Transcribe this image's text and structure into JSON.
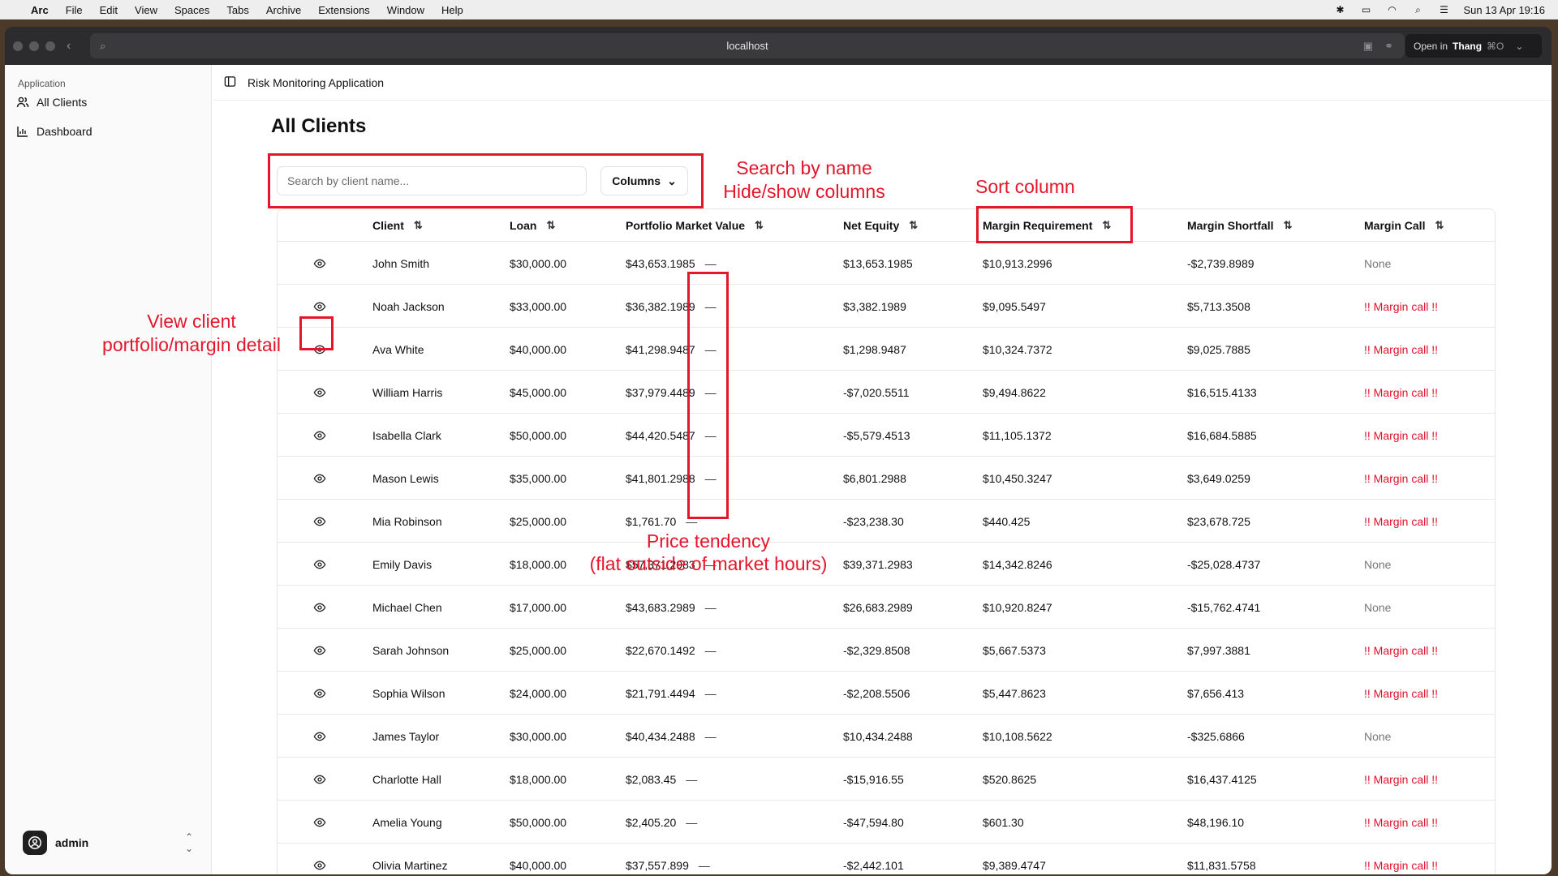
{
  "menubar": {
    "app": "Arc",
    "items": [
      "File",
      "Edit",
      "View",
      "Spaces",
      "Tabs",
      "Archive",
      "Extensions",
      "Window",
      "Help"
    ],
    "datetime": "Sun 13 Apr  19:16"
  },
  "browser": {
    "url": "localhost",
    "open_in_label": "Open in",
    "open_in_target": "Thang",
    "open_in_shortcut": "⌘O"
  },
  "sidebar": {
    "group_label": "Application",
    "items": [
      {
        "label": "All Clients",
        "icon": "users-icon"
      },
      {
        "label": "Dashboard",
        "icon": "chart-icon"
      }
    ],
    "user": "admin"
  },
  "header": {
    "breadcrumb": "Risk Monitoring Application"
  },
  "page": {
    "title": "All Clients",
    "search_placeholder": "Search by client name...",
    "columns_label": "Columns"
  },
  "table": {
    "headers": [
      "Client",
      "Loan",
      "Portfolio Market Value",
      "Net Equity",
      "Margin Requirement",
      "Margin Shortfall",
      "Margin Call"
    ],
    "trend_symbol": "—",
    "rows": [
      {
        "client": "John Smith",
        "loan": "$30,000.00",
        "pmv": "$43,653.1985",
        "equity": "$13,653.1985",
        "req": "$10,913.2996",
        "shortfall": "-$2,739.8989",
        "call": "None"
      },
      {
        "client": "Noah Jackson",
        "loan": "$33,000.00",
        "pmv": "$36,382.1989",
        "equity": "$3,382.1989",
        "req": "$9,095.5497",
        "shortfall": "$5,713.3508",
        "call": "!! Margin call !!"
      },
      {
        "client": "Ava White",
        "loan": "$40,000.00",
        "pmv": "$41,298.9487",
        "equity": "$1,298.9487",
        "req": "$10,324.7372",
        "shortfall": "$9,025.7885",
        "call": "!! Margin call !!"
      },
      {
        "client": "William Harris",
        "loan": "$45,000.00",
        "pmv": "$37,979.4489",
        "equity": "-$7,020.5511",
        "req": "$9,494.8622",
        "shortfall": "$16,515.4133",
        "call": "!! Margin call !!"
      },
      {
        "client": "Isabella Clark",
        "loan": "$50,000.00",
        "pmv": "$44,420.5487",
        "equity": "-$5,579.4513",
        "req": "$11,105.1372",
        "shortfall": "$16,684.5885",
        "call": "!! Margin call !!"
      },
      {
        "client": "Mason Lewis",
        "loan": "$35,000.00",
        "pmv": "$41,801.2988",
        "equity": "$6,801.2988",
        "req": "$10,450.3247",
        "shortfall": "$3,649.0259",
        "call": "!! Margin call !!"
      },
      {
        "client": "Mia Robinson",
        "loan": "$25,000.00",
        "pmv": "$1,761.70",
        "equity": "-$23,238.30",
        "req": "$440.425",
        "shortfall": "$23,678.725",
        "call": "!! Margin call !!"
      },
      {
        "client": "Emily Davis",
        "loan": "$18,000.00",
        "pmv": "$57,371.2983",
        "equity": "$39,371.2983",
        "req": "$14,342.8246",
        "shortfall": "-$25,028.4737",
        "call": "None"
      },
      {
        "client": "Michael Chen",
        "loan": "$17,000.00",
        "pmv": "$43,683.2989",
        "equity": "$26,683.2989",
        "req": "$10,920.8247",
        "shortfall": "-$15,762.4741",
        "call": "None"
      },
      {
        "client": "Sarah Johnson",
        "loan": "$25,000.00",
        "pmv": "$22,670.1492",
        "equity": "-$2,329.8508",
        "req": "$5,667.5373",
        "shortfall": "$7,997.3881",
        "call": "!! Margin call !!"
      },
      {
        "client": "Sophia Wilson",
        "loan": "$24,000.00",
        "pmv": "$21,791.4494",
        "equity": "-$2,208.5506",
        "req": "$5,447.8623",
        "shortfall": "$7,656.413",
        "call": "!! Margin call !!"
      },
      {
        "client": "James Taylor",
        "loan": "$30,000.00",
        "pmv": "$40,434.2488",
        "equity": "$10,434.2488",
        "req": "$10,108.5622",
        "shortfall": "-$325.6866",
        "call": "None"
      },
      {
        "client": "Charlotte Hall",
        "loan": "$18,000.00",
        "pmv": "$2,083.45",
        "equity": "-$15,916.55",
        "req": "$520.8625",
        "shortfall": "$16,437.4125",
        "call": "!! Margin call !!"
      },
      {
        "client": "Amelia Young",
        "loan": "$50,000.00",
        "pmv": "$2,405.20",
        "equity": "-$47,594.80",
        "req": "$601.30",
        "shortfall": "$48,196.10",
        "call": "!! Margin call !!"
      },
      {
        "client": "Olivia Martinez",
        "loan": "$40,000.00",
        "pmv": "$37,557.899",
        "equity": "-$2,442.101",
        "req": "$9,389.4747",
        "shortfall": "$11,831.5758",
        "call": "!! Margin call !!"
      }
    ]
  },
  "annotations": {
    "search": "Search by name",
    "columns": "Hide/show columns",
    "sort": "Sort column",
    "view_line1": "View client",
    "view_line2": "portfolio/margin detail",
    "trend_line1": "Price tendency",
    "trend_line2": "(flat outside of market hours)"
  },
  "colors": {
    "annotation": "#e3162b",
    "margin_call": "#e0102a"
  }
}
